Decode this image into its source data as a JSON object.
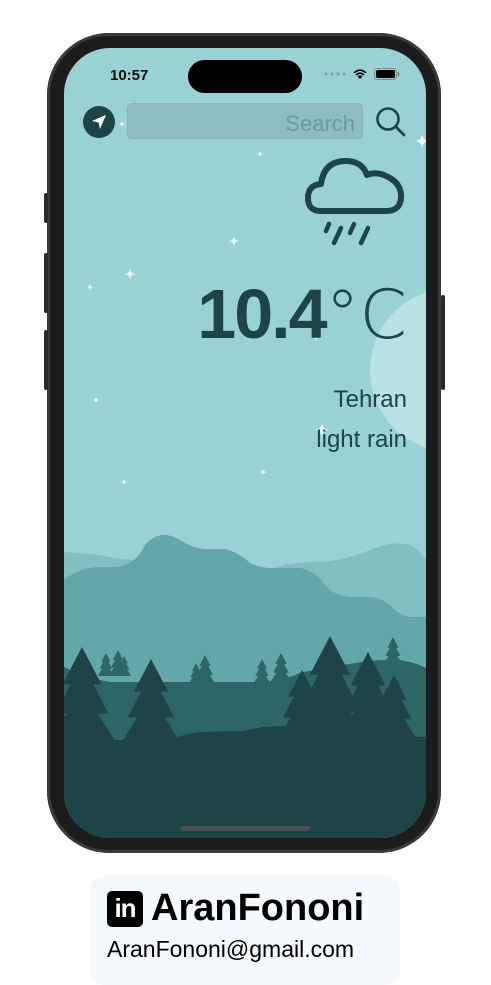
{
  "status_bar": {
    "time": "10:57"
  },
  "search": {
    "placeholder": "Search"
  },
  "weather": {
    "temperature": "10.4",
    "unit": "°C",
    "city": "Tehran",
    "description": "light rain",
    "icon": "cloud-rain-icon"
  },
  "footer": {
    "name": "AranFononi",
    "email": "AranFononi@gmail.com",
    "logo_text": "in"
  },
  "colors": {
    "sky": "#99d1d4",
    "dark": "#1e4448",
    "mid": "#2e6567",
    "mountain": "#64a7aa",
    "hill": "#82bfc1"
  }
}
